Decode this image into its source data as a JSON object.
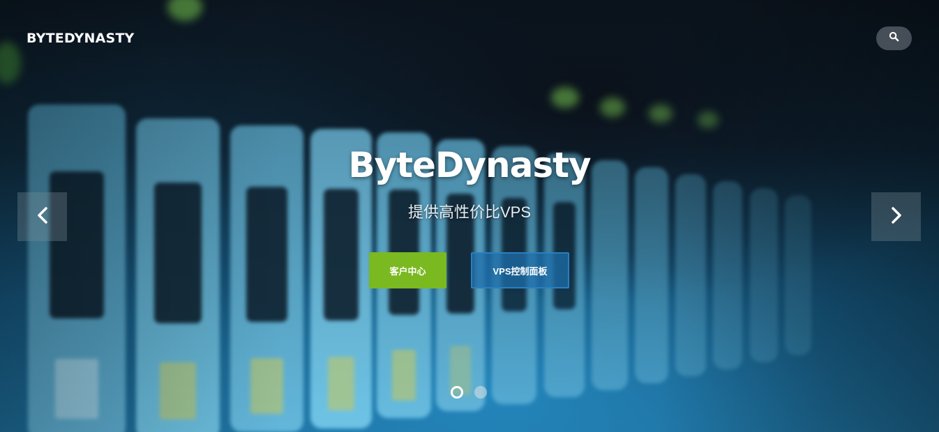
{
  "header": {
    "logo_text": "BYTEDYNASTY",
    "search_icon": "search-icon"
  },
  "slide": {
    "title": "ByteDynasty",
    "subtitle": "提供高性价比VPS",
    "primary_button": "客户中心",
    "secondary_button": "VPS控制面板"
  },
  "carousel": {
    "prev_icon": "chevron-left-icon",
    "next_icon": "chevron-right-icon",
    "slide_count": 2,
    "active_index": 0
  },
  "colors": {
    "primary_button": "#7ab920",
    "secondary_button_border": "#2a7fc0",
    "text": "#ffffff"
  }
}
